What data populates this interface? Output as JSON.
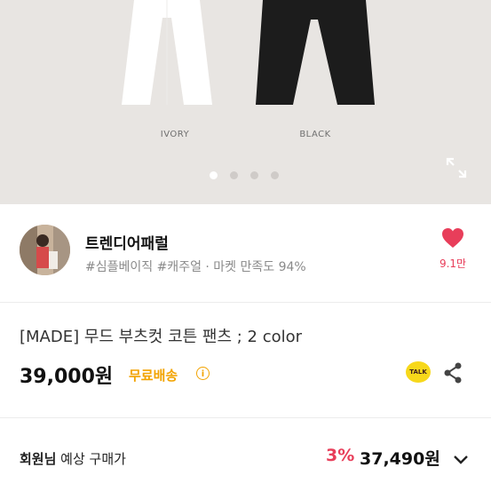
{
  "hero": {
    "variants": [
      {
        "label": "IVORY",
        "color": "#ffffff"
      },
      {
        "label": "BLACK",
        "color": "#1c1c1c"
      }
    ],
    "carousel_pages": 4,
    "active_page": 1
  },
  "store": {
    "name": "트렌디어패럴",
    "meta": "#심플베이직 #캐주얼 · 마켓 만족도 94%",
    "like_count": "9.1만"
  },
  "product": {
    "title": "[MADE] 무드 부츠컷 코튼 팬츠 ; 2 color",
    "price": "39,000원",
    "shipping": "무료배송",
    "talk_label": "TALK"
  },
  "member_price": {
    "label_bold": "회원님",
    "label_rest": " 예상 구매가",
    "discount": "3%",
    "price": "37,490원"
  },
  "colors": {
    "accent_pink": "#e83e5a",
    "shipping_yellow": "#f2a300",
    "kakao_yellow": "#f7d81b"
  }
}
